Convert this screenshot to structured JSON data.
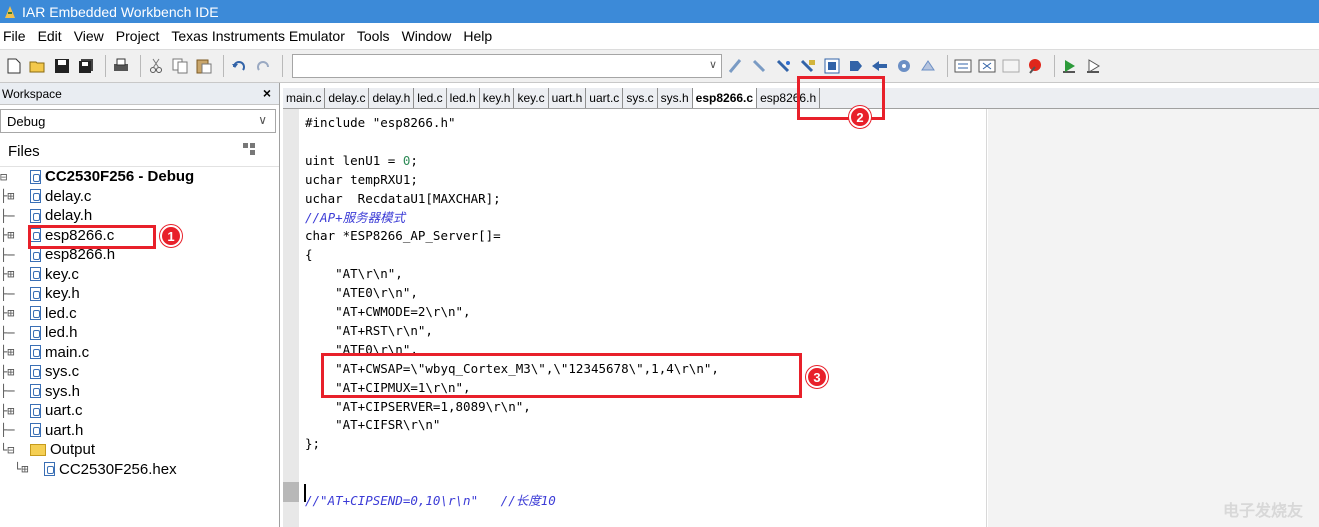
{
  "window": {
    "title": "IAR Embedded Workbench IDE"
  },
  "menu": [
    "File",
    "Edit",
    "View",
    "Project",
    "Texas Instruments Emulator",
    "Tools",
    "Window",
    "Help"
  ],
  "toolbar": {
    "left_icons": [
      "new-icon",
      "open-icon",
      "save-icon",
      "save-all-icon",
      "print-icon",
      "cut-icon",
      "copy-icon",
      "paste-icon",
      "undo-icon",
      "redo-icon"
    ],
    "search_value": "",
    "right_icons": [
      "find-icon",
      "find-prev-icon",
      "find-next-icon",
      "replace-icon",
      "bookmark-icon",
      "goto-icon",
      "browse-icon",
      "compile-icon",
      "make-icon",
      "stop-icon",
      "breakpoint-icon",
      "debug-icon",
      "download-icon"
    ]
  },
  "workspace": {
    "panel_title": "Workspace",
    "config": "Debug",
    "files_header": "Files",
    "tree": [
      {
        "prefix": "⊟",
        "icon": "project",
        "label": "CC2530F256 - Debug",
        "bold": true
      },
      {
        "prefix": "├⊞",
        "icon": "c",
        "label": "delay.c"
      },
      {
        "prefix": "├─",
        "icon": "h",
        "label": "delay.h"
      },
      {
        "prefix": "├⊞",
        "icon": "c",
        "label": "esp8266.c"
      },
      {
        "prefix": "├─",
        "icon": "h",
        "label": "esp8266.h"
      },
      {
        "prefix": "├⊞",
        "icon": "c",
        "label": "key.c"
      },
      {
        "prefix": "├─",
        "icon": "h",
        "label": "key.h"
      },
      {
        "prefix": "├⊞",
        "icon": "c",
        "label": "led.c"
      },
      {
        "prefix": "├─",
        "icon": "h",
        "label": "led.h"
      },
      {
        "prefix": "├⊞",
        "icon": "c",
        "label": "main.c"
      },
      {
        "prefix": "├⊞",
        "icon": "c",
        "label": "sys.c"
      },
      {
        "prefix": "├─",
        "icon": "h",
        "label": "sys.h"
      },
      {
        "prefix": "├⊞",
        "icon": "c",
        "label": "uart.c"
      },
      {
        "prefix": "├─",
        "icon": "h",
        "label": "uart.h"
      },
      {
        "prefix": "└⊟",
        "icon": "folder",
        "label": "Output"
      },
      {
        "prefix": " └⊞",
        "icon": "file",
        "label": "CC2530F256.hex"
      }
    ]
  },
  "tabs": [
    "main.c",
    "delay.c",
    "delay.h",
    "led.c",
    "led.h",
    "key.h",
    "key.c",
    "uart.h",
    "uart.c",
    "sys.c",
    "sys.h",
    "esp8266.c",
    "esp8266.h"
  ],
  "active_tab": "esp8266.c",
  "code_lines": [
    {
      "text": "#include \"esp8266.h\"",
      "cls": "kw"
    },
    {
      "text": "",
      "cls": ""
    },
    {
      "text": "uint lenU1 = 0;",
      "cls": "kw"
    },
    {
      "text": "uchar tempRXU1;",
      "cls": "kw"
    },
    {
      "text": "uchar  RecdataU1[MAXCHAR];",
      "cls": "kw"
    },
    {
      "text": "//AP+服务器模式",
      "cls": "cm"
    },
    {
      "text": "char *ESP8266_AP_Server[]=",
      "cls": "kw"
    },
    {
      "text": "{",
      "cls": "kw"
    },
    {
      "text": "    \"AT\\r\\n\",",
      "cls": "str"
    },
    {
      "text": "    \"ATE0\\r\\n\",",
      "cls": "str"
    },
    {
      "text": "    \"AT+CWMODE=2\\r\\n\",",
      "cls": "str"
    },
    {
      "text": "    \"AT+RST\\r\\n\",",
      "cls": "str"
    },
    {
      "text": "    \"ATE0\\r\\n\",",
      "cls": "str"
    },
    {
      "text": "    \"AT+CWSAP=\\\"wbyq_Cortex_M3\\\",\\\"12345678\\\",1,4\\r\\n\",",
      "cls": "str"
    },
    {
      "text": "    \"AT+CIPMUX=1\\r\\n\",",
      "cls": "str"
    },
    {
      "text": "    \"AT+CIPSERVER=1,8089\\r\\n\",",
      "cls": "str"
    },
    {
      "text": "    \"AT+CIFSR\\r\\n\"",
      "cls": "str"
    },
    {
      "text": "};",
      "cls": "kw"
    },
    {
      "text": "",
      "cls": ""
    },
    {
      "text": "",
      "cls": ""
    },
    {
      "text": "//\"AT+CIPSEND=0,10\\r\\n\"   //长度10",
      "cls": "cm"
    }
  ],
  "annotations": [
    "1",
    "2",
    "3"
  ],
  "watermark": "电子发烧友",
  "colors": {
    "titlebar": "#3c8ad8",
    "annotation": "#e8202a"
  }
}
